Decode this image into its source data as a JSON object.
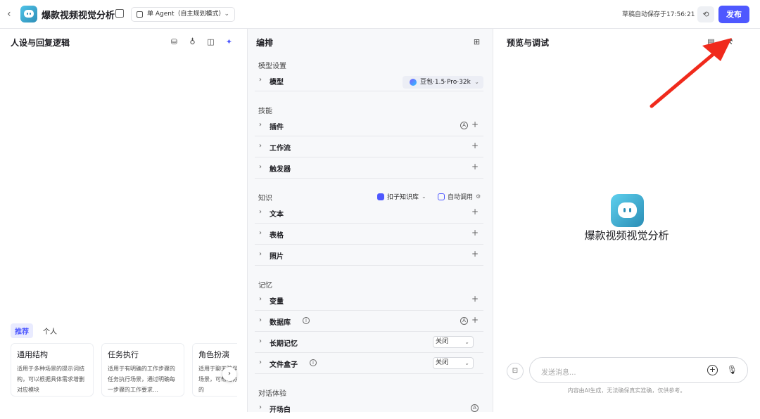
{
  "header": {
    "back": "‹",
    "app_title": "爆款视频视觉分析",
    "agent_mode": "单 Agent（自主规划模式）",
    "draft_status": "草稿自动保存于17:56:21",
    "publish": "发布"
  },
  "left": {
    "title": "人设与回复逻辑",
    "tabs": [
      "推荐",
      "个人"
    ],
    "cards": [
      {
        "title": "通用结构",
        "desc": "适用于多种场景的提示词结构，可以根据具体需求增删对应模块"
      },
      {
        "title": "任务执行",
        "desc": "适用于有明确的工作步骤的任务执行场景，通过明确每一步骤的工作要求…"
      },
      {
        "title": "角色扮演",
        "desc": "适用于聊天陪伴、互动娱乐场景，可帮助你塑造个性化的"
      }
    ],
    "next": "›"
  },
  "middle": {
    "title": "编排",
    "sections": {
      "model_settings": "模型设置",
      "skills": "技能",
      "knowledge": "知识",
      "memory": "记忆",
      "dialog": "对话体验"
    },
    "model_label": "模型",
    "model_value": "豆包·1.5·Pro·32k",
    "skills": [
      "插件",
      "工作流",
      "触发器"
    ],
    "knowledge_source": "扣子知识库",
    "knowledge_call": "自动调用",
    "knowledge": [
      "文本",
      "表格",
      "照片"
    ],
    "memory": [
      "变量",
      "数据库",
      "长期记忆",
      "文件盒子"
    ],
    "long_memory_value": "关闭",
    "file_box_value": "关闭",
    "dialog": [
      "开场白"
    ]
  },
  "right": {
    "title": "预览与调试",
    "bot_name": "爆款视频视觉分析",
    "input_placeholder": "发送消息...",
    "disclaimer": "内容由AI生成，无法确保真实准确，仅供参考。"
  },
  "colors": {
    "accent": "#4e58ff",
    "arrow": "#f02a1c"
  }
}
